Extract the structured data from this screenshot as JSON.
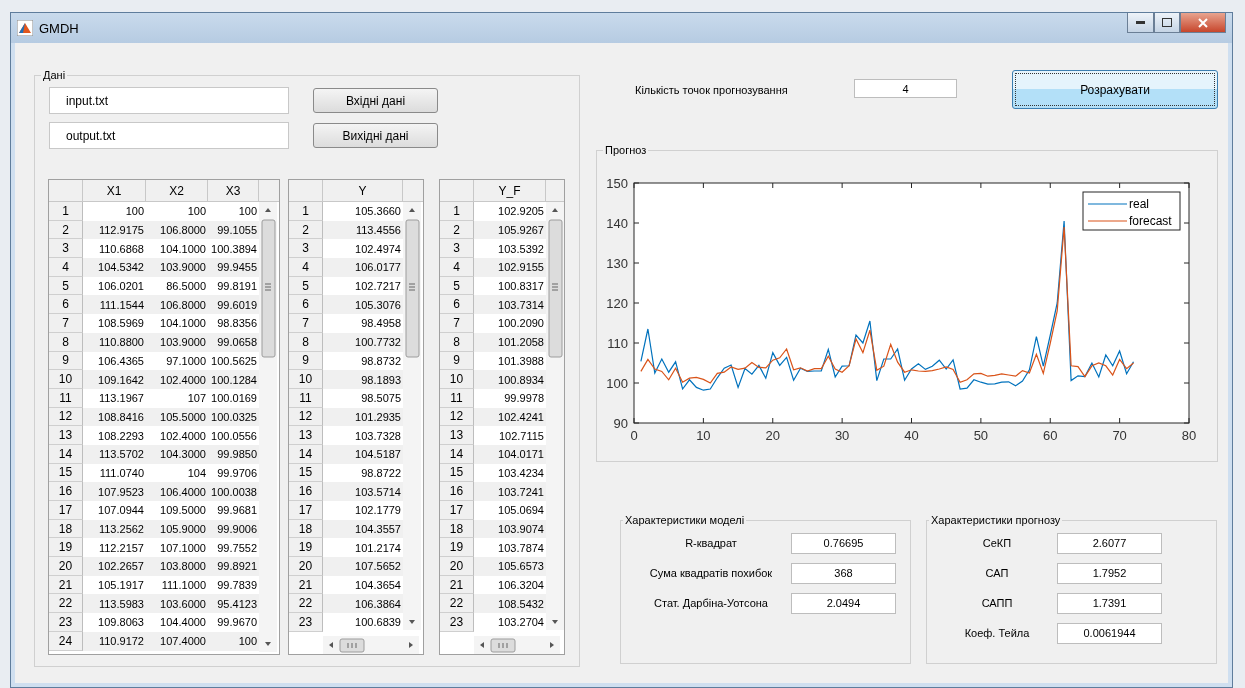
{
  "window": {
    "title": "GMDH"
  },
  "data_panel": {
    "title": "Дані",
    "files": [
      {
        "value": "input.txt",
        "button": "Вхідні дані"
      },
      {
        "value": "output.txt",
        "button": "Вихідні дані"
      }
    ],
    "input_table": {
      "columns": [
        "X1",
        "X2",
        "X3"
      ],
      "rows": [
        {
          "index": "1",
          "cells": [
            "100",
            "100",
            "100"
          ]
        },
        {
          "index": "2",
          "cells": [
            "112.9175",
            "106.8000",
            "99.1055"
          ]
        },
        {
          "index": "3",
          "cells": [
            "110.6868",
            "104.1000",
            "100.3894"
          ]
        },
        {
          "index": "4",
          "cells": [
            "104.5342",
            "103.9000",
            "99.9455"
          ]
        },
        {
          "index": "5",
          "cells": [
            "106.0201",
            "86.5000",
            "99.8191"
          ]
        },
        {
          "index": "6",
          "cells": [
            "111.1544",
            "106.8000",
            "99.6019"
          ]
        },
        {
          "index": "7",
          "cells": [
            "108.5969",
            "104.1000",
            "98.8356"
          ]
        },
        {
          "index": "8",
          "cells": [
            "110.8800",
            "103.9000",
            "99.0658"
          ]
        },
        {
          "index": "9",
          "cells": [
            "106.4365",
            "97.1000",
            "100.5625"
          ]
        },
        {
          "index": "10",
          "cells": [
            "109.1642",
            "102.4000",
            "100.1284"
          ]
        },
        {
          "index": "11",
          "cells": [
            "113.1967",
            "107",
            "100.0169"
          ]
        },
        {
          "index": "12",
          "cells": [
            "108.8416",
            "105.5000",
            "100.0325"
          ]
        },
        {
          "index": "13",
          "cells": [
            "108.2293",
            "102.4000",
            "100.0556"
          ]
        },
        {
          "index": "14",
          "cells": [
            "113.5702",
            "104.3000",
            "99.9850"
          ]
        },
        {
          "index": "15",
          "cells": [
            "111.0740",
            "104",
            "99.9706"
          ]
        },
        {
          "index": "16",
          "cells": [
            "107.9523",
            "106.4000",
            "100.0038"
          ]
        },
        {
          "index": "17",
          "cells": [
            "107.0944",
            "109.5000",
            "99.9681"
          ]
        },
        {
          "index": "18",
          "cells": [
            "113.2562",
            "105.9000",
            "99.9006"
          ]
        },
        {
          "index": "19",
          "cells": [
            "112.2157",
            "107.1000",
            "99.7552"
          ]
        },
        {
          "index": "20",
          "cells": [
            "102.2657",
            "103.8000",
            "99.8921"
          ]
        },
        {
          "index": "21",
          "cells": [
            "105.1917",
            "111.1000",
            "99.7839"
          ]
        },
        {
          "index": "22",
          "cells": [
            "113.5983",
            "103.6000",
            "95.4123"
          ]
        },
        {
          "index": "23",
          "cells": [
            "109.8063",
            "104.4000",
            "99.9670"
          ]
        },
        {
          "index": "24",
          "cells": [
            "110.9172",
            "107.4000",
            "100"
          ]
        }
      ]
    },
    "output_table": {
      "columns": [
        "Y"
      ],
      "rows": [
        {
          "index": "1",
          "cells": [
            "105.3660"
          ]
        },
        {
          "index": "2",
          "cells": [
            "113.4556"
          ]
        },
        {
          "index": "3",
          "cells": [
            "102.4974"
          ]
        },
        {
          "index": "4",
          "cells": [
            "106.0177"
          ]
        },
        {
          "index": "5",
          "cells": [
            "102.7217"
          ]
        },
        {
          "index": "6",
          "cells": [
            "105.3076"
          ]
        },
        {
          "index": "7",
          "cells": [
            "98.4958"
          ]
        },
        {
          "index": "8",
          "cells": [
            "100.7732"
          ]
        },
        {
          "index": "9",
          "cells": [
            "98.8732"
          ]
        },
        {
          "index": "10",
          "cells": [
            "98.1893"
          ]
        },
        {
          "index": "11",
          "cells": [
            "98.5075"
          ]
        },
        {
          "index": "12",
          "cells": [
            "101.2935"
          ]
        },
        {
          "index": "13",
          "cells": [
            "103.7328"
          ]
        },
        {
          "index": "14",
          "cells": [
            "104.5187"
          ]
        },
        {
          "index": "15",
          "cells": [
            "98.8722"
          ]
        },
        {
          "index": "16",
          "cells": [
            "103.5714"
          ]
        },
        {
          "index": "17",
          "cells": [
            "102.1779"
          ]
        },
        {
          "index": "18",
          "cells": [
            "104.3557"
          ]
        },
        {
          "index": "19",
          "cells": [
            "101.2174"
          ]
        },
        {
          "index": "20",
          "cells": [
            "107.5652"
          ]
        },
        {
          "index": "21",
          "cells": [
            "104.3654"
          ]
        },
        {
          "index": "22",
          "cells": [
            "106.3864"
          ]
        },
        {
          "index": "23",
          "cells": [
            "100.6839"
          ]
        }
      ]
    },
    "forecast_table": {
      "columns": [
        "Y_F"
      ],
      "rows": [
        {
          "index": "1",
          "cells": [
            "102.9205"
          ]
        },
        {
          "index": "2",
          "cells": [
            "105.9267"
          ]
        },
        {
          "index": "3",
          "cells": [
            "103.5392"
          ]
        },
        {
          "index": "4",
          "cells": [
            "102.9155"
          ]
        },
        {
          "index": "5",
          "cells": [
            "100.8317"
          ]
        },
        {
          "index": "6",
          "cells": [
            "103.7314"
          ]
        },
        {
          "index": "7",
          "cells": [
            "100.2090"
          ]
        },
        {
          "index": "8",
          "cells": [
            "101.2058"
          ]
        },
        {
          "index": "9",
          "cells": [
            "101.3988"
          ]
        },
        {
          "index": "10",
          "cells": [
            "100.8934"
          ]
        },
        {
          "index": "11",
          "cells": [
            "99.9978"
          ]
        },
        {
          "index": "12",
          "cells": [
            "102.4241"
          ]
        },
        {
          "index": "13",
          "cells": [
            "102.7115"
          ]
        },
        {
          "index": "14",
          "cells": [
            "104.0171"
          ]
        },
        {
          "index": "15",
          "cells": [
            "103.4234"
          ]
        },
        {
          "index": "16",
          "cells": [
            "103.7241"
          ]
        },
        {
          "index": "17",
          "cells": [
            "105.0694"
          ]
        },
        {
          "index": "18",
          "cells": [
            "103.9074"
          ]
        },
        {
          "index": "19",
          "cells": [
            "103.7874"
          ]
        },
        {
          "index": "20",
          "cells": [
            "105.6573"
          ]
        },
        {
          "index": "21",
          "cells": [
            "106.3204"
          ]
        },
        {
          "index": "22",
          "cells": [
            "108.5432"
          ]
        },
        {
          "index": "23",
          "cells": [
            "103.2704"
          ]
        }
      ]
    }
  },
  "forecast_points": {
    "label": "Кількість точок прогнозування",
    "value": "4"
  },
  "calculate_button": "Розрахувати",
  "forecast_panel": {
    "title": "Прогноз",
    "chart_data": {
      "type": "line",
      "x": [
        1,
        2,
        3,
        4,
        5,
        6,
        7,
        8,
        9,
        10,
        11,
        12,
        13,
        14,
        15,
        16,
        17,
        18,
        19,
        20,
        21,
        22,
        23,
        24,
        25,
        26,
        27,
        28,
        29,
        30,
        31,
        32,
        33,
        34,
        35,
        36,
        37,
        38,
        39,
        40,
        41,
        42,
        43,
        44,
        45,
        46,
        47,
        48,
        49,
        50,
        51,
        52,
        53,
        54,
        55,
        56,
        57,
        58,
        59,
        60,
        61,
        62,
        63,
        64,
        65,
        66,
        67,
        68,
        69,
        70,
        71,
        72
      ],
      "series": [
        {
          "name": "real",
          "color": "#0072bd",
          "values": [
            105.4,
            113.5,
            102.5,
            106,
            102.7,
            105.3,
            98.5,
            100.8,
            98.9,
            98.2,
            98.5,
            101.3,
            103.7,
            104.5,
            98.9,
            103.6,
            102.2,
            104.4,
            101.2,
            107.6,
            104.4,
            106.4,
            100.7,
            103.7,
            102.9,
            103,
            103,
            108.4,
            101.5,
            104.2,
            104.3,
            112,
            110,
            115.5,
            100.6,
            106,
            106,
            108.5,
            100.7,
            103.5,
            104.8,
            103.4,
            104.2,
            105.7,
            103.5,
            105.8,
            98.5,
            98.7,
            100.8,
            100.2,
            99.7,
            99.8,
            100.2,
            100.3,
            99.3,
            100.5,
            103.3,
            111.6,
            104.2,
            112,
            120,
            140.5,
            100.6,
            101.8,
            101.6,
            105,
            101.5,
            107,
            104.3,
            108,
            102.3,
            105.3
          ]
        },
        {
          "name": "forecast",
          "color": "#d95319",
          "values": [
            102.9,
            105.9,
            103.5,
            102.9,
            100.8,
            103.7,
            100.2,
            101.2,
            101.4,
            100.9,
            100,
            102.4,
            102.7,
            104,
            103.4,
            103.7,
            105.1,
            103.9,
            103.8,
            105.7,
            106.3,
            108.5,
            103.3,
            103.8,
            103,
            103.6,
            103.6,
            106.7,
            103.5,
            102.7,
            104.3,
            111,
            107.6,
            113.2,
            103.2,
            104.2,
            109.7,
            105.2,
            102.7,
            103.3,
            103,
            102.9,
            103.1,
            103.5,
            104,
            103.4,
            100.2,
            100.8,
            102.3,
            102.4,
            101.7,
            101.9,
            102.3,
            102,
            101.7,
            103.1,
            102.5,
            107.2,
            102.4,
            110,
            118,
            139,
            104.3,
            104.1,
            101.6,
            104.3,
            105,
            104.3,
            102,
            105.9,
            103.6,
            105
          ]
        }
      ],
      "legend": true,
      "xlim": [
        0,
        80
      ],
      "ylim": [
        90,
        150
      ],
      "xticks": [
        0,
        10,
        20,
        30,
        40,
        50,
        60,
        70,
        80
      ],
      "yticks": [
        90,
        100,
        110,
        120,
        130,
        140,
        150
      ]
    }
  },
  "model_stats": {
    "title": "Характеристики моделі",
    "items": [
      {
        "label": "R-квадрат",
        "value": "0.76695"
      },
      {
        "label": "Сума квадратів похибок",
        "value": "368"
      },
      {
        "label": "Стат. Дарбіна-Уотсона",
        "value": "2.0494"
      }
    ]
  },
  "forecast_stats": {
    "title": "Характеристики прогнозу",
    "items": [
      {
        "label": "СеКП",
        "value": "2.6077"
      },
      {
        "label": "САП",
        "value": "1.7952"
      },
      {
        "label": "САПП",
        "value": "1.7391"
      },
      {
        "label": "Коеф. Тейла",
        "value": "0.0061944"
      }
    ]
  }
}
